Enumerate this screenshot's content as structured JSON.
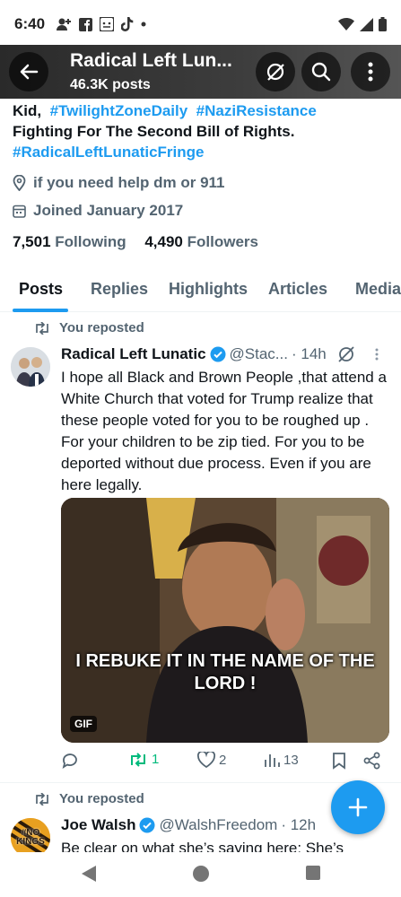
{
  "status_bar": {
    "time": "6:40",
    "icons": [
      "person-add-icon",
      "facebook-icon",
      "wechat-icon",
      "tiktok-icon",
      "dot-icon"
    ],
    "right_icons": [
      "wifi-icon",
      "signal-icon",
      "battery-icon"
    ]
  },
  "header": {
    "title": "Radical Left Lun...",
    "posts_count": "46.3K posts"
  },
  "bio": {
    "line1_text": "Kid,",
    "line1_tag1": "#TwilightZoneDaily",
    "line1_tag2": "#NaziResistance",
    "line2": "Fighting For The Second Bill of Rights.",
    "line3_tag": "#RadicalLeftLunaticFringe"
  },
  "location": "if you need help dm or 911",
  "joined": "Joined January 2017",
  "follow": {
    "following_count": "7,501",
    "following_label": "Following",
    "followers_count": "4,490",
    "followers_label": "Followers"
  },
  "tabs": [
    "Posts",
    "Replies",
    "Highlights",
    "Articles",
    "Media"
  ],
  "posts": [
    {
      "repost_label": "You reposted",
      "name": "Radical Left Lunatic",
      "handle": "@Stac...",
      "time": "· 14h",
      "text": "I hope all Black and Brown People ,that attend a White Church that voted for Trump realize that these people voted for you to be roughed up . For your children to be zip tied. For you to be deported without due process. Even if you are here legally.",
      "media_caption": "I REBUKE IT IN THE NAME OF THE LORD !",
      "media_badge": "GIF",
      "reposts": "1",
      "likes": "2",
      "views": "13"
    },
    {
      "repost_label": "You reposted",
      "name": "Joe Walsh",
      "handle": "@WalshFreedom",
      "time": "· 12h",
      "text": "Be clear on what she’s saying here: She’s",
      "avatar_text": "#NO KINGS"
    }
  ],
  "colors": {
    "accent": "#1d9bf0",
    "repost_green": "#00ba7c",
    "muted": "#536471"
  }
}
